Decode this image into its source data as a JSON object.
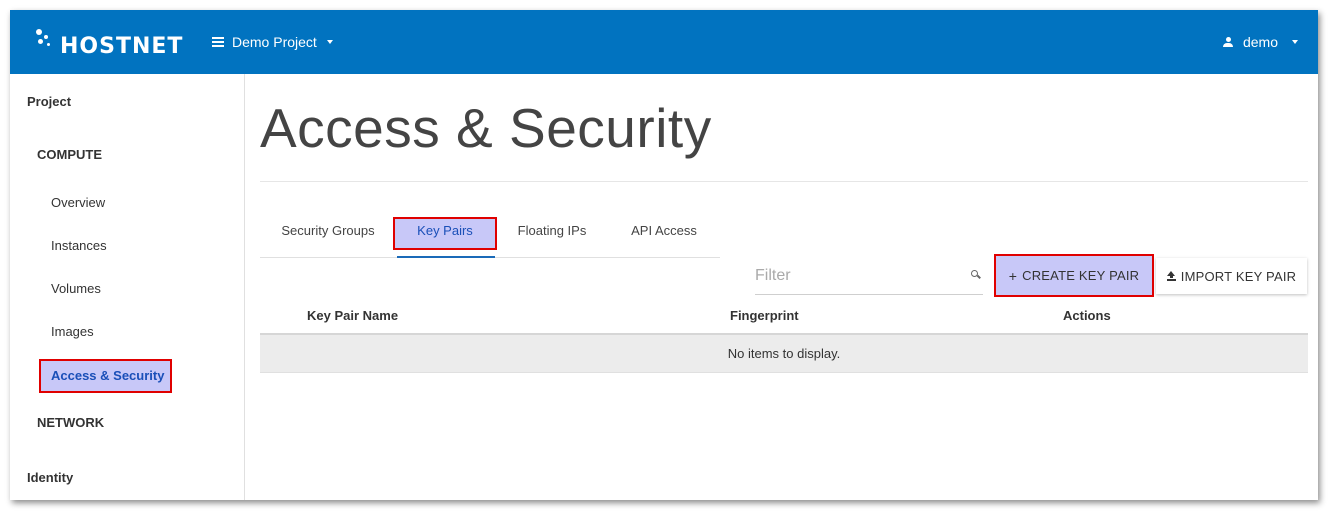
{
  "header": {
    "logo_text": "HOSTNET",
    "project_selector": "Demo Project",
    "user": "demo"
  },
  "sidebar": {
    "project": "Project",
    "compute": "COMPUTE",
    "items": [
      {
        "label": "Overview"
      },
      {
        "label": "Instances"
      },
      {
        "label": "Volumes"
      },
      {
        "label": "Images"
      },
      {
        "label": "Access & Security"
      }
    ],
    "network": "NETWORK",
    "identity": "Identity"
  },
  "main": {
    "title": "Access & Security",
    "tabs": [
      {
        "label": "Security Groups"
      },
      {
        "label": "Key Pairs"
      },
      {
        "label": "Floating IPs"
      },
      {
        "label": "API Access"
      }
    ],
    "active_tab": "Key Pairs",
    "filter_placeholder": "Filter",
    "create_button": "CREATE KEY PAIR",
    "create_button_prefix": "+",
    "import_button": "IMPORT KEY PAIR",
    "table": {
      "columns": [
        "Key Pair Name",
        "Fingerprint",
        "Actions"
      ],
      "empty_message": "No items to display."
    }
  },
  "colors": {
    "header_bg": "#0173c0",
    "highlight_fill": "#c8c8f8",
    "highlight_border": "#e00000",
    "active_text": "#1a4fb8"
  }
}
